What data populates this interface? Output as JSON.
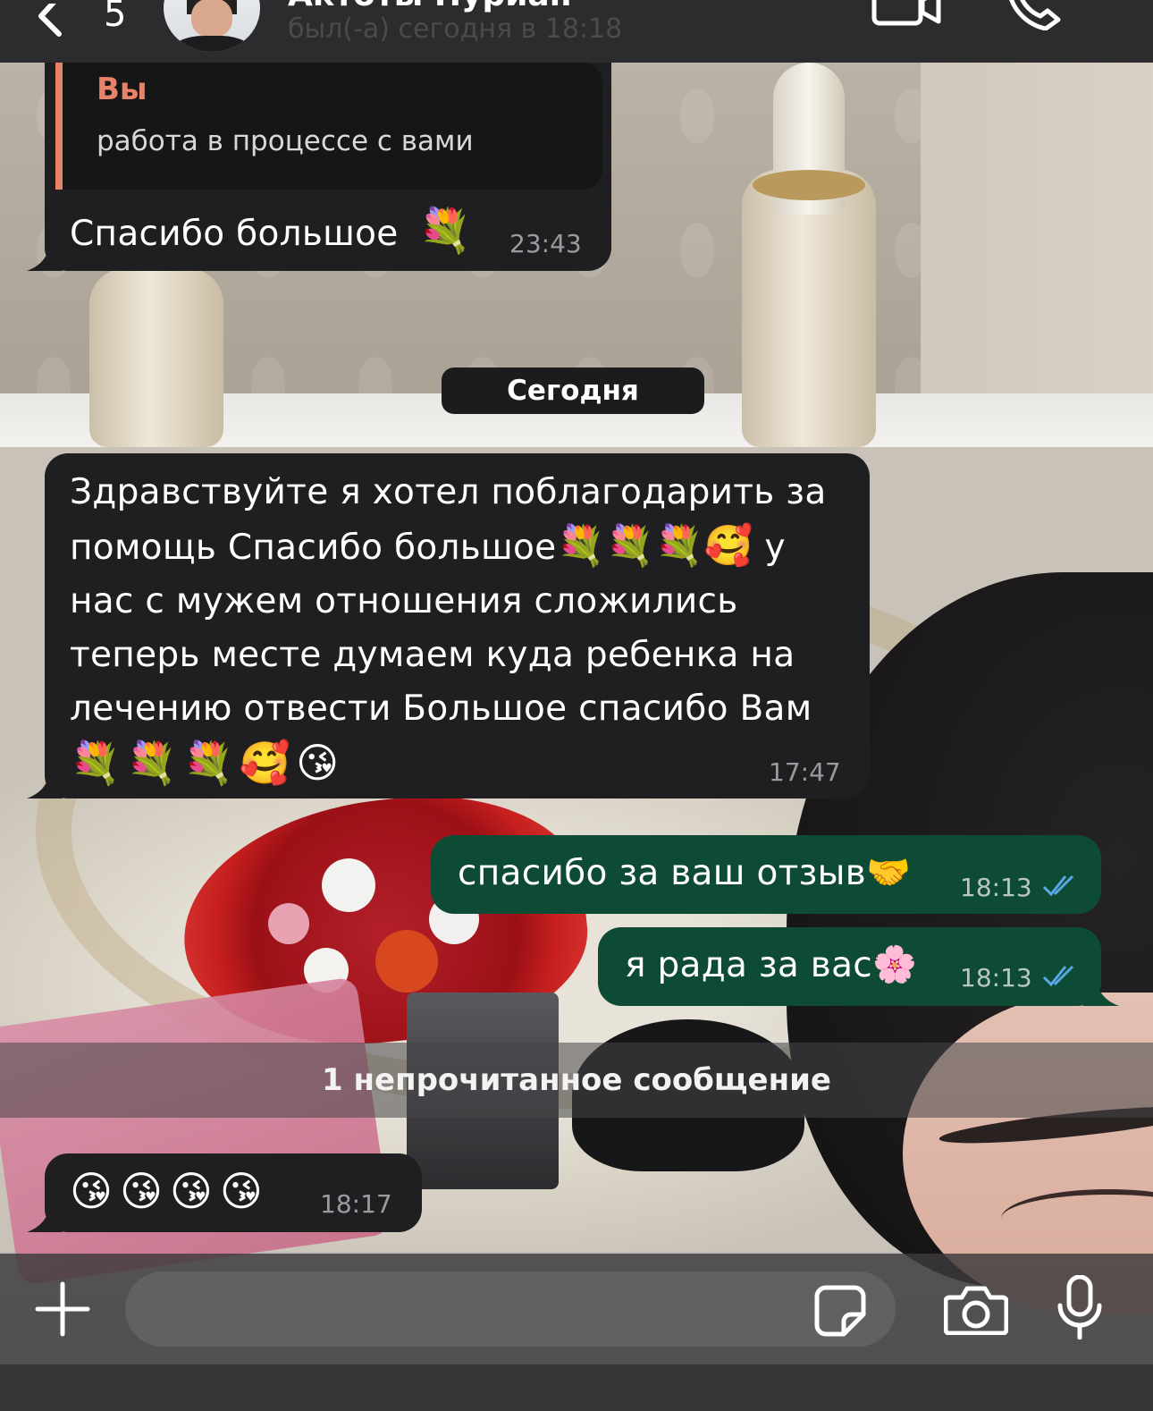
{
  "header": {
    "back_count": "5",
    "contact_name": "Актоты Нуриан",
    "status": "был(-а) сегодня в 18:18"
  },
  "messages": {
    "m1": {
      "reply_sender": "Вы",
      "reply_text": "работа в процессе с вами",
      "text": "Спасибо большое",
      "emoji": "💐",
      "time": "23:43"
    },
    "date_separator": "Сегодня",
    "m2": {
      "line1": "Здравствуйте я хотел поблагодарить за",
      "line2_a": "помощь Спасибо большое",
      "line2_emoji": "💐💐💐🥰",
      "line2_b": " у",
      "line3": "нас с мужем отношения сложились",
      "line4": "теперь месте  думаем куда ребенка на",
      "line5": "лечению отвести Большое спасибо Вам",
      "line6_emoji": "💐💐💐🥰😘",
      "time": "17:47"
    },
    "m3": {
      "text": "спасибо за ваш отзыв",
      "emoji": "🤝",
      "time": "18:13",
      "status": "read"
    },
    "m4": {
      "text": "я рада за вас",
      "emoji": "🌸",
      "time": "18:13",
      "status": "read"
    },
    "unread_label": "1 непрочитанное сообщение",
    "m5": {
      "emoji": "😘😘😘😘",
      "time": "18:17"
    }
  },
  "composer": {
    "placeholder": "",
    "icons": [
      "plus-icon",
      "sticker-icon",
      "camera-icon",
      "microphone-icon"
    ]
  },
  "colors": {
    "incoming_bubble": "#1f1f21",
    "outgoing_bubble": "#0e4b34",
    "reply_accent": "#e8836a",
    "read_check": "#5aa7e6"
  }
}
